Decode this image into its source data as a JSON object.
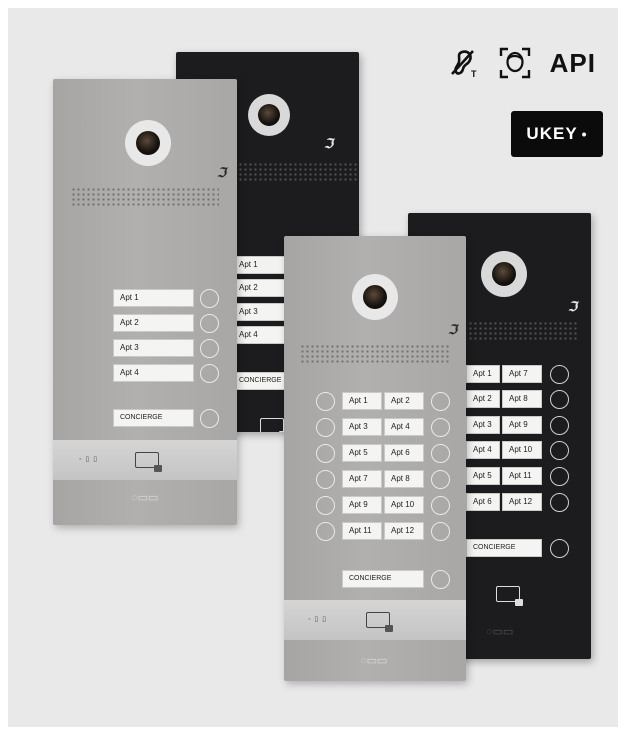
{
  "badges": {
    "api_label": "API",
    "ukey_label": "UKEY",
    "ukey_dot": "•",
    "hearing_icon": "hearing-loop-icon",
    "face_icon": "face-recognition-icon"
  },
  "panels": {
    "silver_4": {
      "apartments": [
        "Apt 1",
        "Apt 2",
        "Apt 3",
        "Apt 4"
      ],
      "concierge": "CONCIERGE",
      "strip_text": "◦ ▯ ▯"
    },
    "black_4": {
      "apartments": [
        "Apt 1",
        "Apt 2",
        "Apt 3",
        "Apt 4"
      ],
      "concierge": "CONCIERGE"
    },
    "silver_12": {
      "left_column": [
        "Apt 1",
        "Apt 3",
        "Apt 5",
        "Apt 7",
        "Apt 9",
        "Apt 11"
      ],
      "right_column": [
        "Apt 2",
        "Apt 4",
        "Apt 6",
        "Apt 8",
        "Apt 10",
        "Apt 12"
      ],
      "concierge": "CONCIERGE",
      "strip_text": "◦ ▯ ▯"
    },
    "black_12": {
      "left_column": [
        "Apt 1",
        "Apt 2",
        "Apt 3",
        "Apt 4",
        "Apt 5",
        "Apt 6"
      ],
      "right_column": [
        "Apt 7",
        "Apt 8",
        "Apt 9",
        "Apt 10",
        "Apt 11",
        "Apt 12"
      ],
      "concierge": "CONCIERGE"
    }
  },
  "colors": {
    "silver": "#aeacaa",
    "black": "#1c1c1e",
    "background": "#e9e9ea"
  }
}
